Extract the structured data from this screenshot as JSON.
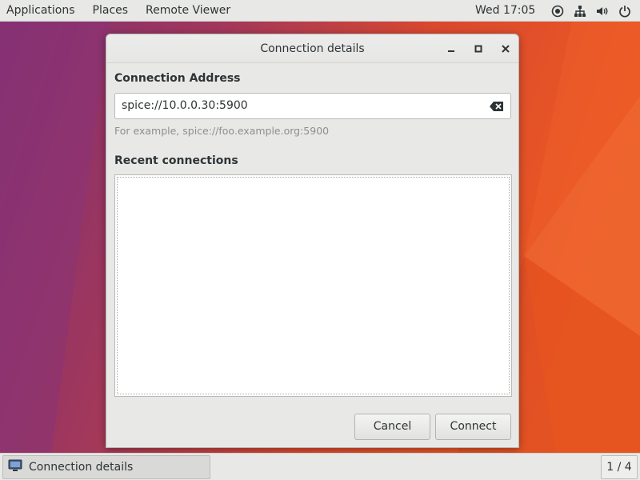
{
  "topbar": {
    "applications": "Applications",
    "places": "Places",
    "app_menu": "Remote Viewer",
    "clock": "Wed 17:05",
    "tray_icons": [
      "accessibility-icon",
      "network-icon",
      "volume-icon",
      "power-icon"
    ]
  },
  "dialog": {
    "title": "Connection details",
    "address_label": "Connection Address",
    "address_value": "spice://10.0.0.30:5900",
    "hint": "For example, spice://foo.example.org:5900",
    "recent_label": "Recent connections",
    "cancel_label": "Cancel",
    "connect_label": "Connect"
  },
  "taskbar": {
    "window_item": "Connection details",
    "workspace": "1 / 4"
  },
  "colors": {
    "wallpaper_left": "#7d2d72",
    "wallpaper_right": "#e95420",
    "panel": "#e8e8e7"
  }
}
